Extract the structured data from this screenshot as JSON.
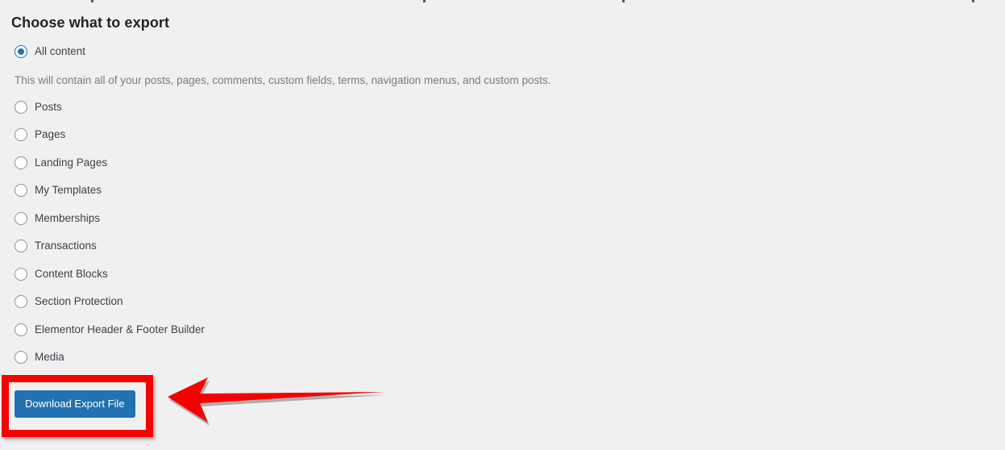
{
  "page": {
    "title": "Choose what to export",
    "background_color": "#f0f0f1"
  },
  "export_options": {
    "selected": "All content",
    "description": "This will contain all of your posts, pages, comments, custom fields, terms, navigation menus, and custom posts.",
    "items": [
      {
        "label": "All content",
        "checked": true
      },
      {
        "label": "Posts",
        "checked": false
      },
      {
        "label": "Pages",
        "checked": false
      },
      {
        "label": "Landing Pages",
        "checked": false
      },
      {
        "label": "My Templates",
        "checked": false
      },
      {
        "label": "Memberships",
        "checked": false
      },
      {
        "label": "Transactions",
        "checked": false
      },
      {
        "label": "Content Blocks",
        "checked": false
      },
      {
        "label": "Section Protection",
        "checked": false
      },
      {
        "label": "Elementor Header & Footer Builder",
        "checked": false
      },
      {
        "label": "Media",
        "checked": false
      }
    ]
  },
  "actions": {
    "download_label": "Download Export File",
    "button_color": "#2271b1",
    "button_text_color": "#ffffff"
  },
  "annotations": {
    "highlight_color": "#f80000",
    "highlight_target": "Download Export File",
    "arrow_direction": "left",
    "arrow_color": "#f80000"
  }
}
